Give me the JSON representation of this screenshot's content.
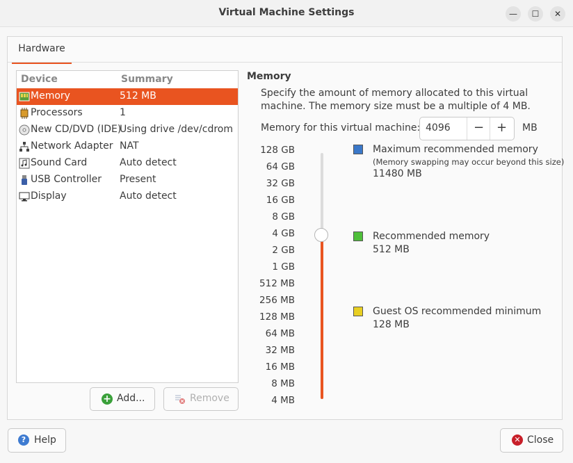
{
  "window": {
    "title": "Virtual Machine Settings",
    "minimize_glyph": "—",
    "maximize_glyph": "☐",
    "close_glyph": "✕"
  },
  "tabs": [
    {
      "label": "Hardware"
    }
  ],
  "device_list": {
    "header": {
      "device": "Device",
      "summary": "Summary"
    },
    "rows": [
      {
        "name": "Memory",
        "summary": "512 MB",
        "icon": "memory-icon"
      },
      {
        "name": "Processors",
        "summary": "1",
        "icon": "processor-icon"
      },
      {
        "name": "New CD/DVD (IDE)",
        "summary": "Using drive /dev/cdrom",
        "icon": "cd-dvd-icon"
      },
      {
        "name": "Network Adapter",
        "summary": "NAT",
        "icon": "network-icon"
      },
      {
        "name": "Sound Card",
        "summary": "Auto detect",
        "icon": "sound-icon"
      },
      {
        "name": "USB Controller",
        "summary": "Present",
        "icon": "usb-icon"
      },
      {
        "name": "Display",
        "summary": "Auto detect",
        "icon": "display-icon"
      }
    ],
    "selected": 0
  },
  "buttons": {
    "add": "Add...",
    "remove": "Remove",
    "help": "Help",
    "close": "Close"
  },
  "memory": {
    "title": "Memory",
    "description": "Specify the amount of memory allocated to this virtual machine. The memory size must be a multiple of 4 MB.",
    "field_label": "Memory for this virtual machine:",
    "value": "4096",
    "decrement": "−",
    "increment": "+",
    "unit": "MB",
    "scale": [
      "128 GB",
      "64 GB",
      "32 GB",
      "16 GB",
      "8 GB",
      "4 GB",
      "2 GB",
      "1 GB",
      "512 MB",
      "256 MB",
      "128 MB",
      "64 MB",
      "32 MB",
      "16 MB",
      "8 MB",
      "4 MB"
    ],
    "legend": [
      {
        "title": "Maximum recommended memory",
        "note": "(Memory swapping may occur beyond this size)",
        "value": "11480 MB",
        "color": "#3a78c9"
      },
      {
        "title": "Recommended memory",
        "note": "",
        "value": "512 MB",
        "color": "#4fbf3a"
      },
      {
        "title": "Guest OS recommended minimum",
        "note": "",
        "value": "128 MB",
        "color": "#e8cf22"
      }
    ]
  },
  "colors": {
    "accent": "#e95420",
    "help_icon": "#3e7bd1",
    "close_icon": "#c8202a",
    "add_icon": "#3aa03a"
  }
}
